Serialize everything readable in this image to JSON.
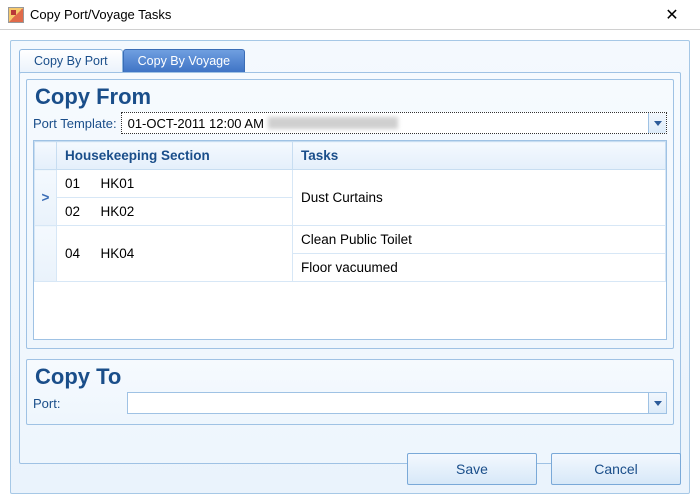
{
  "window": {
    "title": "Copy Port/Voyage Tasks"
  },
  "tabs": {
    "port": "Copy By Port",
    "voyage": "Copy By Voyage",
    "active": "voyage"
  },
  "copy_from": {
    "heading": "Copy From",
    "template_label": "Port Template:",
    "template_value": "01-OCT-2011 12:00 AM",
    "headers": {
      "section": "Housekeeping Section",
      "tasks": "Tasks"
    },
    "rows": [
      {
        "indicator": ">",
        "code": "01",
        "section": "HK01",
        "tasks": [
          "Dust Curtains"
        ],
        "section_rowspan": 1
      },
      {
        "indicator": "",
        "code": "02",
        "section": "HK02",
        "tasks": [],
        "section_rowspan": 1
      },
      {
        "indicator": "",
        "code": "04",
        "section": "HK04",
        "tasks": [
          "Clean Public Toilet",
          "Floor vacuumed"
        ],
        "section_rowspan": 2
      }
    ]
  },
  "copy_to": {
    "heading": "Copy To",
    "port_label": "Port:",
    "port_value": ""
  },
  "buttons": {
    "save": "Save",
    "cancel": "Cancel"
  }
}
